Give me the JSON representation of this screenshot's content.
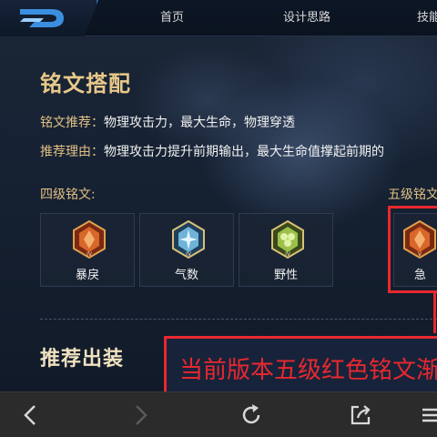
{
  "nav": {
    "items": [
      "首页",
      "设计思路",
      "技能"
    ]
  },
  "rune": {
    "title": "铭文搭配",
    "recommend_label": "铭文推荐：",
    "recommend_value": "物理攻击力，最大生命，物理穿透",
    "reason_label": "推荐理由：",
    "reason_value": "物理攻击力提升前期输出，最大生命值撑起前期的",
    "level4_label": "四级铭文:",
    "level5_label": "五级铭文",
    "cards": [
      {
        "name": "暴戾",
        "icon": "red-rune-icon",
        "color": "#d8672a"
      },
      {
        "name": "气数",
        "icon": "blue-rune-icon",
        "color": "#6fb4d8"
      },
      {
        "name": "野性",
        "icon": "green-rune-icon",
        "color": "#9cc04a"
      },
      {
        "name": "急",
        "icon": "red-rune-icon",
        "color": "#d8672a"
      }
    ]
  },
  "outfit": {
    "title": "推荐出装"
  },
  "annotation": {
    "callout_text": "当前版本五级红色铭文渐",
    "color": "#e8282f"
  },
  "toolbar": {
    "back": "back-arrow-icon",
    "forward": "forward-arrow-icon",
    "refresh": "refresh-icon",
    "share": "share-icon",
    "menu": "menu-icon"
  }
}
